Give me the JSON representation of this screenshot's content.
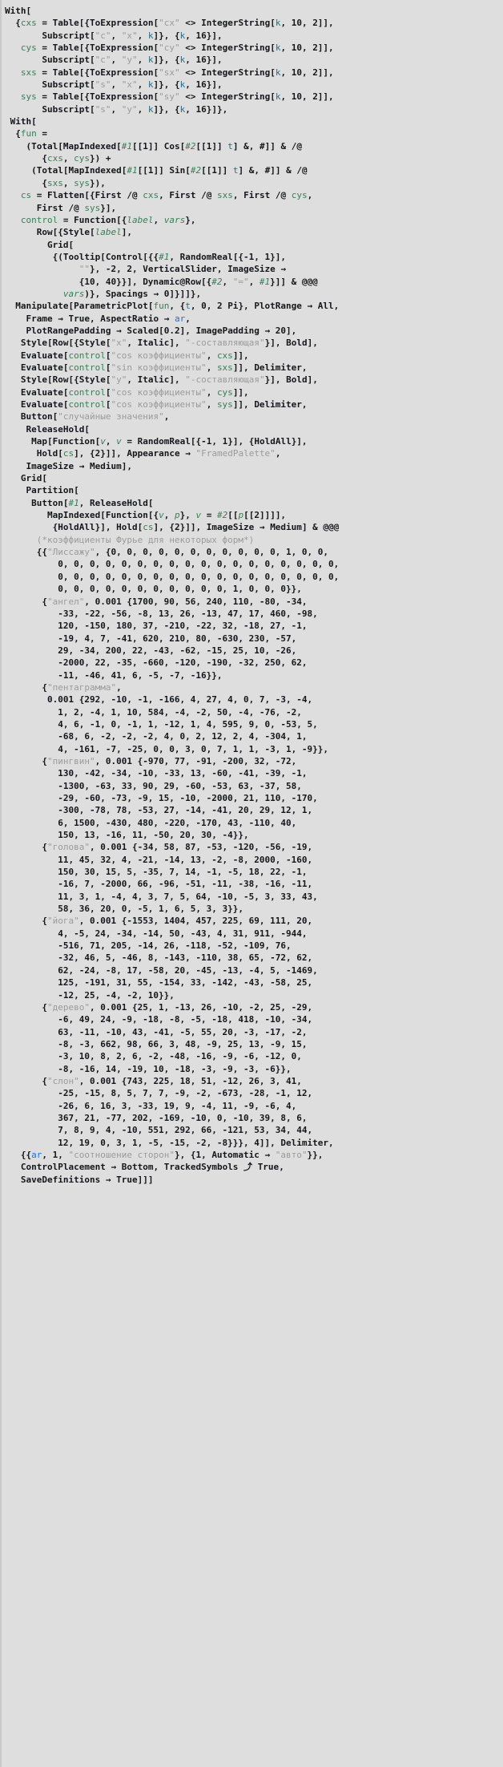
{
  "window": {
    "kind": "mathematica-notebook-cell",
    "cell_background": "#dedede",
    "text_color": "#15161a",
    "bracket_color": "#c9c9c9"
  },
  "syntax_colors": {
    "symbol_green": "#3a7d55",
    "string_gray": "#9b9b9b",
    "iterator_teal": "#2a6b8a",
    "dynamic_blue": "#1f6fd6",
    "comment_gray": "#9b9b9b",
    "default": "#15161a"
  },
  "code": {
    "language": "Wolfram Language",
    "lines": [
      "With[",
      "  {cxs = Table[{ToExpression[\"cx\" <> IntegerString[k, 10, 2]],",
      "       Subscript[\"c\", \"x\", k]}, {k, 16}],",
      "   cys = Table[{ToExpression[\"cy\" <> IntegerString[k, 10, 2]],",
      "       Subscript[\"c\", \"y\", k]}, {k, 16}],",
      "   sxs = Table[{ToExpression[\"sx\" <> IntegerString[k, 10, 2]],",
      "       Subscript[\"s\", \"x\", k]}, {k, 16}],",
      "   sys = Table[{ToExpression[\"sy\" <> IntegerString[k, 10, 2]],",
      "       Subscript[\"s\", \"y\", k]}, {k, 16}]},",
      " With[",
      "  {fun =",
      "    (Total[MapIndexed[#1[[1]] Cos[#2[[1]] t] &, #]] & /@",
      "       {cxs, cys}) +",
      "     (Total[MapIndexed[#1[[1]] Sin[#2[[1]] t] &, #]] & /@",
      "       {sxs, sys}),",
      "   cs = Flatten[{First /@ cxs, First /@ sxs, First /@ cys,",
      "      First /@ sys}],",
      "   control = Function[{label, vars},",
      "      Row[{Style[label],",
      "        Grid[",
      "         {(Tooltip[Control[{{#1, RandomReal[{-1, 1}],",
      "              \"\"}, -2, 2, VerticalSlider, ImageSize →",
      "              {10, 40}}], Dynamic@Row[{#2, \"=\", #1}]] & @@@",
      "           vars)}, Spacings → 0]}]]},",
      "  Manipulate[ParametricPlot[fun, {t, 0, 2 Pi}, PlotRange → All,",
      "    Frame → True, AspectRatio → ar,",
      "    PlotRangePadding → Scaled[0.2], ImagePadding → 20],",
      "   Style[Row[{Style[\"x\", Italic], \"-составляющая\"}], Bold],",
      "   Evaluate[control[\"cos коэффициенты\", cxs]],",
      "   Evaluate[control[\"sin коэффициенты\", sxs]], Delimiter,",
      "   Style[Row[{Style[\"y\", Italic], \"-составляющая\"}], Bold],",
      "   Evaluate[control[\"cos коэффициенты\", cys]],",
      "   Evaluate[control[\"cos коэффициенты\", sys]], Delimiter,",
      "   Button[\"случайные значения\",",
      "    ReleaseHold[",
      "     Map[Function[v, v = RandomReal[{-1, 1}], {HoldAll}],",
      "      Hold[cs], {2}]], Appearance → \"FramedPalette\",",
      "    ImageSize → Medium],",
      "   Grid[",
      "    Partition[",
      "     Button[#1, ReleaseHold[",
      "        MapIndexed[Function[{v, p}, v = #2[[p[[2]]]],",
      "         {HoldAll}], Hold[cs], {2}]], ImageSize → Medium] & @@@",
      "      (*коэффициенты Фурье для некоторых форм*)",
      "      {{\"Лиссажу\", {0, 0, 0, 0, 0, 0, 0, 0, 0, 0, 0, 1, 0, 0,",
      "          0, 0, 0, 0, 0, 0, 0, 0, 0, 0, 0, 0, 0, 0, 0, 0, 0, 0,",
      "          0, 0, 0, 0, 0, 0, 0, 0, 0, 0, 0, 0, 0, 0, 0, 0, 0, 0,",
      "          0, 0, 0, 0, 0, 0, 0, 0, 0, 0, 0, 1, 0, 0, 0}},",
      "       {\"ангел\", 0.001 {1700, 90, 56, 240, 110, -80, -34,",
      "          -33, -22, -56, -8, 13, 26, -13, 47, 17, 460, -98,",
      "          120, -150, 180, 37, -210, -22, 32, -18, 27, -1,",
      "          -19, 4, 7, -41, 620, 210, 80, -630, 230, -57,",
      "          29, -34, 200, 22, -43, -62, -15, 25, 10, -26,",
      "          -2000, 22, -35, -660, -120, -190, -32, 250, 62,",
      "          -11, -46, 41, 6, -5, -7, -16}},",
      "       {\"пентаграмма\",",
      "        0.001 {292, -10, -1, -166, 4, 27, 4, 0, 7, -3, -4,",
      "          1, 2, -4, 1, 10, 584, -4, -2, 50, -4, -76, -2,",
      "          4, 6, -1, 0, -1, 1, -12, 1, 4, 595, 9, 0, -53, 5,",
      "          -68, 6, -2, -2, -2, 4, 0, 2, 12, 2, 4, -304, 1,",
      "          4, -161, -7, -25, 0, 0, 3, 0, 7, 1, 1, -3, 1, -9}},",
      "       {\"пингвин\", 0.001 {-970, 77, -91, -200, 32, -72,",
      "          130, -42, -34, -10, -33, 13, -60, -41, -39, -1,",
      "          -1300, -63, 33, 90, 29, -60, -53, 63, -37, 58,",
      "          -29, -60, -73, -9, 15, -10, -2000, 21, 110, -170,",
      "          -300, -78, 78, -53, 27, -14, -41, 20, 29, 12, 1,",
      "          6, 1500, -430, 480, -220, -170, 43, -110, 40,",
      "          150, 13, -16, 11, -50, 20, 30, -4}},",
      "       {\"голова\", 0.001 {-34, 58, 87, -53, -120, -56, -19,",
      "          11, 45, 32, 4, -21, -14, 13, -2, -8, 2000, -160,",
      "          150, 30, 15, 5, -35, 7, 14, -1, -5, 18, 22, -1,",
      "          -16, 7, -2000, 66, -96, -51, -11, -38, -16, -11,",
      "          11, 3, 1, -4, 4, 3, 7, 5, 64, -10, -5, 3, 33, 43,",
      "          58, 36, 20, 0, -5, 1, 6, 5, 3, 3}},",
      "       {\"йога\", 0.001 {-1553, 1404, 457, 225, 69, 111, 20,",
      "          4, -5, 24, -34, -14, 50, -43, 4, 31, 911, -944,",
      "          -516, 71, 205, -14, 26, -118, -52, -109, 76,",
      "          -32, 46, 5, -46, 8, -143, -110, 38, 65, -72, 62,",
      "          62, -24, -8, 17, -58, 20, -45, -13, -4, 5, -1469,",
      "          125, -191, 31, 55, -154, 33, -142, -43, -58, 25,",
      "          -12, 25, -4, -2, 10}},",
      "       {\"дерево\", 0.001 {25, 1, -13, 26, -10, -2, 25, -29,",
      "          -6, 49, 24, -9, -18, -8, -5, -18, 418, -10, -34,",
      "          63, -11, -10, 43, -41, -5, 55, 20, -3, -17, -2,",
      "          -8, -3, 662, 98, 66, 3, 48, -9, 25, 13, -9, 15,",
      "          -3, 10, 8, 2, 6, -2, -48, -16, -9, -6, -12, 0,",
      "          -8, -16, 14, -19, 10, -18, -3, -9, -3, -6}},",
      "       {\"слон\", 0.001 {743, 225, 18, 51, -12, 26, 3, 41,",
      "          -25, -15, 8, 5, 7, 7, -9, -2, -673, -28, -1, 12,",
      "          -26, 6, 16, 3, -33, 19, 9, -4, 11, -9, -6, 4,",
      "          367, 21, -77, 202, -169, -10, 0, -10, 39, 8, 6,",
      "          7, 8, 9, 4, -10, 551, 292, 66, -121, 53, 34, 44,",
      "          12, 19, 0, 3, 1, -5, -15, -2, -8}}}, 4]], Delimiter,",
      "   {{ar, 1, \"соотношение сторон\"}, {1, Automatic → \"авто\"}},",
      "   ControlPlacement → Bottom, TrackedSymbols ⤴ True,",
      "   SaveDefinitions → True]]]"
    ]
  },
  "tokens": {
    "symbols": [
      "cxs",
      "cys",
      "sxs",
      "sys",
      "fun",
      "cs",
      "control",
      "label",
      "vars",
      "v",
      "p"
    ],
    "iterators": [
      "k",
      "t"
    ],
    "dynamic": [
      "ar"
    ],
    "slots": [
      "#1",
      "#2",
      "#"
    ],
    "strings": [
      "cx",
      "cy",
      "sx",
      "sy",
      "c",
      "x",
      "y",
      "s",
      "",
      "-составляющая",
      "cos коэффициенты",
      "sin коэффициенты",
      "случайные значения",
      "FramedPalette",
      "Лиссажу",
      "ангел",
      "пентаграмма",
      "пингвин",
      "голова",
      "йога",
      "дерево",
      "слон",
      "соотношение сторон",
      "авто"
    ],
    "comment": "(*коэффициенты Фурье для некоторых форм*)"
  }
}
